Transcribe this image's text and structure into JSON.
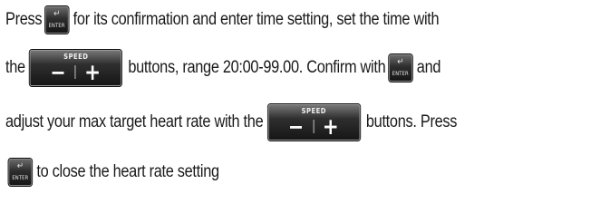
{
  "enter_key": {
    "arrow": "↵",
    "label": "ENTER"
  },
  "speed_key": {
    "caption": "SPEED",
    "minus": "−",
    "plus": "+"
  },
  "text": {
    "l1_a": "Press",
    "l1_b": "for its confirmation and enter time setting, set the time with",
    "l2_a": "the",
    "l2_b": "buttons, range 20:00-99.00. Confirm with",
    "l2_c": "and",
    "l3_a": "adjust your max target heart rate with the",
    "l3_b": "buttons. Press",
    "l4_b": "to close the heart rate setting"
  }
}
